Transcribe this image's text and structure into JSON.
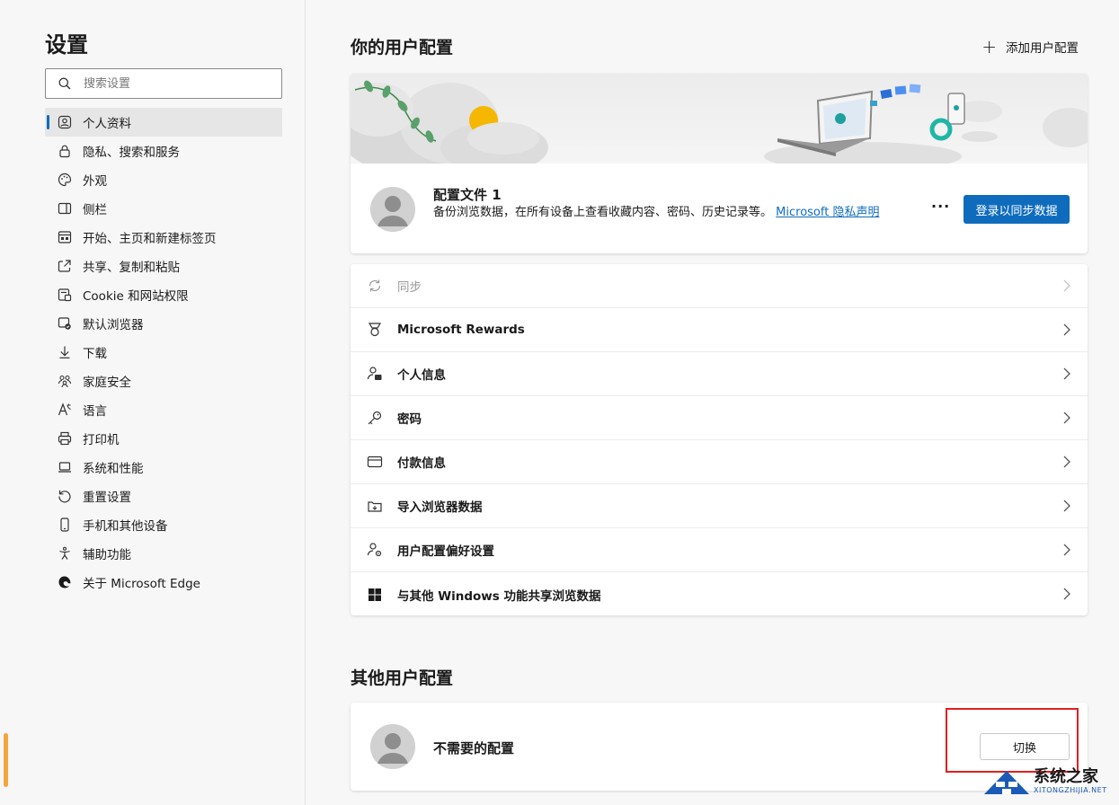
{
  "sidebar": {
    "title": "设置",
    "search_placeholder": "搜索设置",
    "items": [
      {
        "label": "个人资料",
        "icon": "profile-icon",
        "active": true
      },
      {
        "label": "隐私、搜索和服务",
        "icon": "lock-icon"
      },
      {
        "label": "外观",
        "icon": "palette-icon"
      },
      {
        "label": "侧栏",
        "icon": "sidebar-icon"
      },
      {
        "label": "开始、主页和新建标签页",
        "icon": "home-tabs-icon"
      },
      {
        "label": "共享、复制和粘贴",
        "icon": "share-icon"
      },
      {
        "label": "Cookie 和网站权限",
        "icon": "cookie-icon"
      },
      {
        "label": "默认浏览器",
        "icon": "browser-icon"
      },
      {
        "label": "下载",
        "icon": "download-icon"
      },
      {
        "label": "家庭安全",
        "icon": "family-icon"
      },
      {
        "label": "语言",
        "icon": "language-icon"
      },
      {
        "label": "打印机",
        "icon": "printer-icon"
      },
      {
        "label": "系统和性能",
        "icon": "laptop-icon"
      },
      {
        "label": "重置设置",
        "icon": "reset-icon"
      },
      {
        "label": "手机和其他设备",
        "icon": "phone-icon"
      },
      {
        "label": "辅助功能",
        "icon": "accessibility-icon"
      },
      {
        "label": "关于 Microsoft Edge",
        "icon": "edge-icon"
      }
    ]
  },
  "main": {
    "title": "你的用户配置",
    "add_profile_label": "添加用户配置",
    "profile": {
      "name": "配置文件 1",
      "description": "备份浏览数据，在所有设备上查看收藏内容、密码、历史记录等。",
      "privacy_link": "Microsoft 隐私声明",
      "more_label": "···",
      "signin_label": "登录以同步数据"
    },
    "rows": [
      {
        "label": "同步",
        "icon": "sync-icon",
        "disabled": true
      },
      {
        "label": "Microsoft Rewards",
        "icon": "rewards-icon"
      },
      {
        "label": "个人信息",
        "icon": "person-card-icon"
      },
      {
        "label": "密码",
        "icon": "key-icon"
      },
      {
        "label": "付款信息",
        "icon": "card-icon"
      },
      {
        "label": "导入浏览器数据",
        "icon": "import-icon"
      },
      {
        "label": "用户配置偏好设置",
        "icon": "profile-settings-icon"
      },
      {
        "label": "与其他 Windows 功能共享浏览数据",
        "icon": "windows-icon"
      }
    ],
    "other_title": "其他用户配置",
    "other_profile": {
      "name": "不需要的配置",
      "switch_label": "切换"
    }
  },
  "watermark": {
    "text": "系统之家",
    "sub": "XITONGZHIJIA.NET"
  },
  "colors": {
    "accent": "#0f6cbd",
    "highlight": "#e02020"
  }
}
